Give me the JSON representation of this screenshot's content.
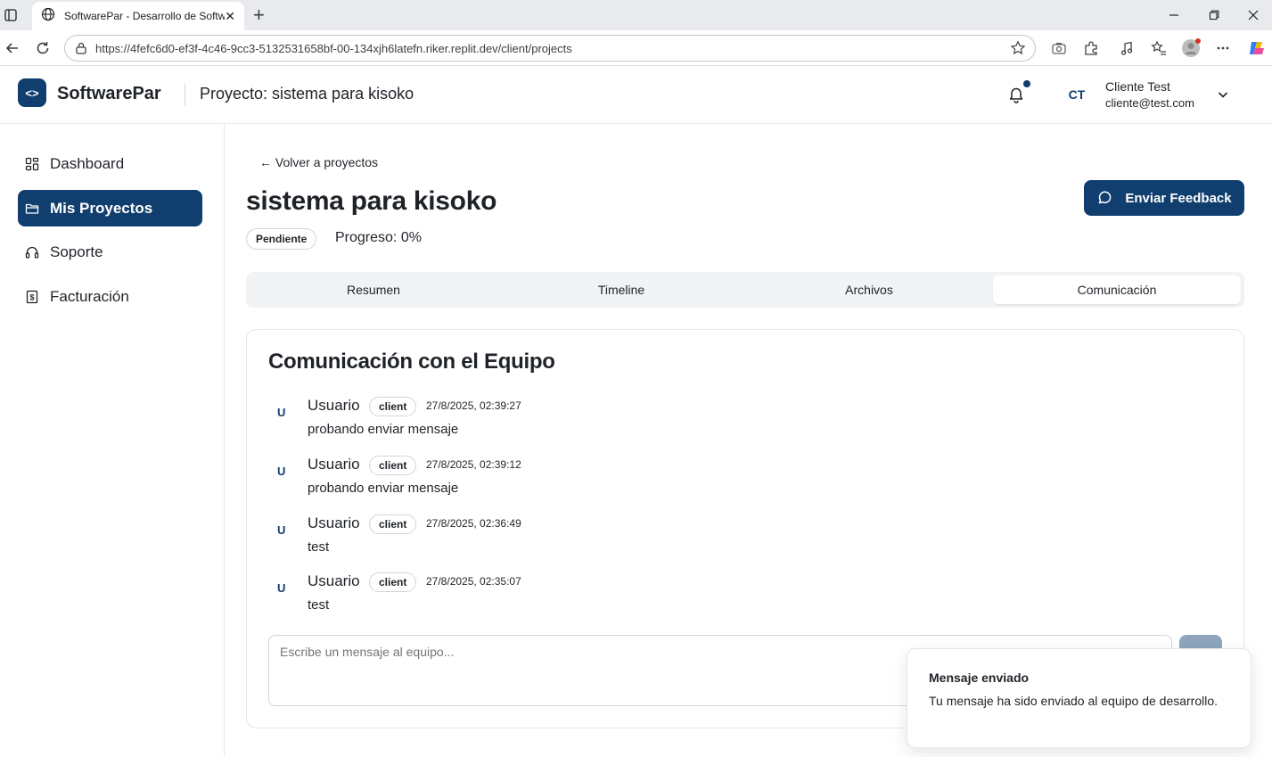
{
  "browser": {
    "tab_title": "SoftwarePar - Desarrollo de Softw",
    "url": "https://4fefc6d0-ef3f-4c46-9cc3-5132531658bf-00-134xjh6latefn.riker.replit.dev/client/projects"
  },
  "header": {
    "logo_symbol": "<>",
    "brand": "SoftwarePar",
    "title": "Proyecto: sistema para kisoko",
    "user_initials": "CT",
    "user_name": "Cliente Test",
    "user_email": "cliente@test.com"
  },
  "sidebar": {
    "items": [
      {
        "label": "Dashboard",
        "icon": "grid-icon"
      },
      {
        "label": "Mis Proyectos",
        "icon": "folder-icon",
        "active": true
      },
      {
        "label": "Soporte",
        "icon": "headset-icon"
      },
      {
        "label": "Facturación",
        "icon": "receipt-icon"
      }
    ]
  },
  "project": {
    "back_link": "← Volver a proyectos",
    "name": "sistema para kisoko",
    "status": "Pendiente",
    "progress_text": "Progreso: 0%",
    "progress_value": 0,
    "feedback_label": "Enviar Feedback"
  },
  "tabs": [
    {
      "label": "Resumen"
    },
    {
      "label": "Timeline"
    },
    {
      "label": "Archivos"
    },
    {
      "label": "Comunicación",
      "active": true
    }
  ],
  "communication": {
    "title": "Comunicación con el Equipo",
    "messages": [
      {
        "initial": "U",
        "author": "Usuario",
        "role": "client",
        "time": "27/8/2025, 02:39:27",
        "text": "probando enviar mensaje"
      },
      {
        "initial": "U",
        "author": "Usuario",
        "role": "client",
        "time": "27/8/2025, 02:39:12",
        "text": "probando enviar mensaje"
      },
      {
        "initial": "U",
        "author": "Usuario",
        "role": "client",
        "time": "27/8/2025, 02:36:49",
        "text": "test"
      },
      {
        "initial": "U",
        "author": "Usuario",
        "role": "client",
        "time": "27/8/2025, 02:35:07",
        "text": "test"
      }
    ],
    "input_placeholder": "Escribe un mensaje al equipo..."
  },
  "toast": {
    "title": "Mensaje enviado",
    "body": "Tu mensaje ha sido enviado al equipo de desarrollo."
  },
  "colors": {
    "primary": "#103e6e",
    "send_button": "#8ea5bd"
  }
}
